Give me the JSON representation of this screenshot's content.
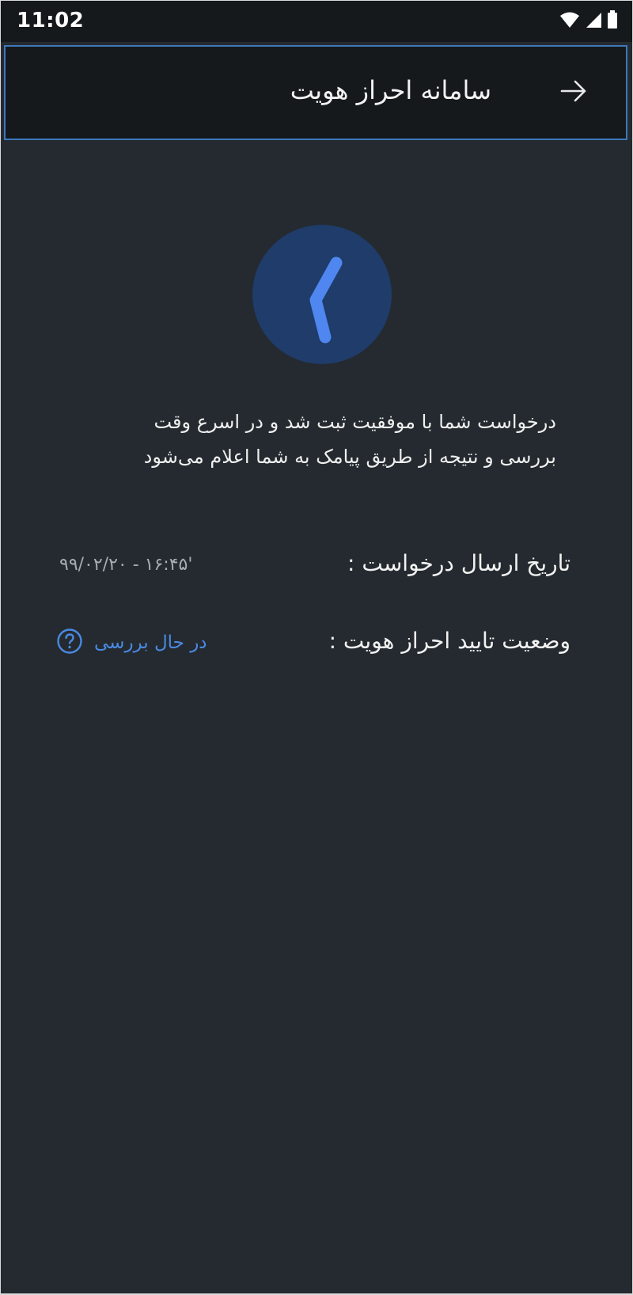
{
  "status_bar": {
    "time": "11:02",
    "icons": [
      "wifi-icon",
      "signal-icon",
      "battery-icon"
    ]
  },
  "app_bar": {
    "title": "سامانه احراز هویت",
    "back_icon": "arrow-right-icon"
  },
  "main": {
    "status_icon": "pending-clock-icon",
    "message_line1": "درخواست شما با موفقیت ثبت شد و در اسرع وقت",
    "message_line2": "بررسی و نتیجه از طریق پیامک به شما اعلام می‌شود",
    "request_date_label": "تاریخ ارسال درخواست :",
    "request_date_value": "۹۹/۰۲/۲۰ - ۱۶:۴۵'",
    "verification_status_label": "وضعیت تایید احراز هویت :",
    "verification_status_value": "در حال بررسی",
    "verification_status_icon": "help-circle-icon"
  },
  "colors": {
    "background": "#242a2f",
    "app_bar": "#15191c",
    "accent": "#4a89e3",
    "spinner_bg": "#1f3c6a"
  }
}
